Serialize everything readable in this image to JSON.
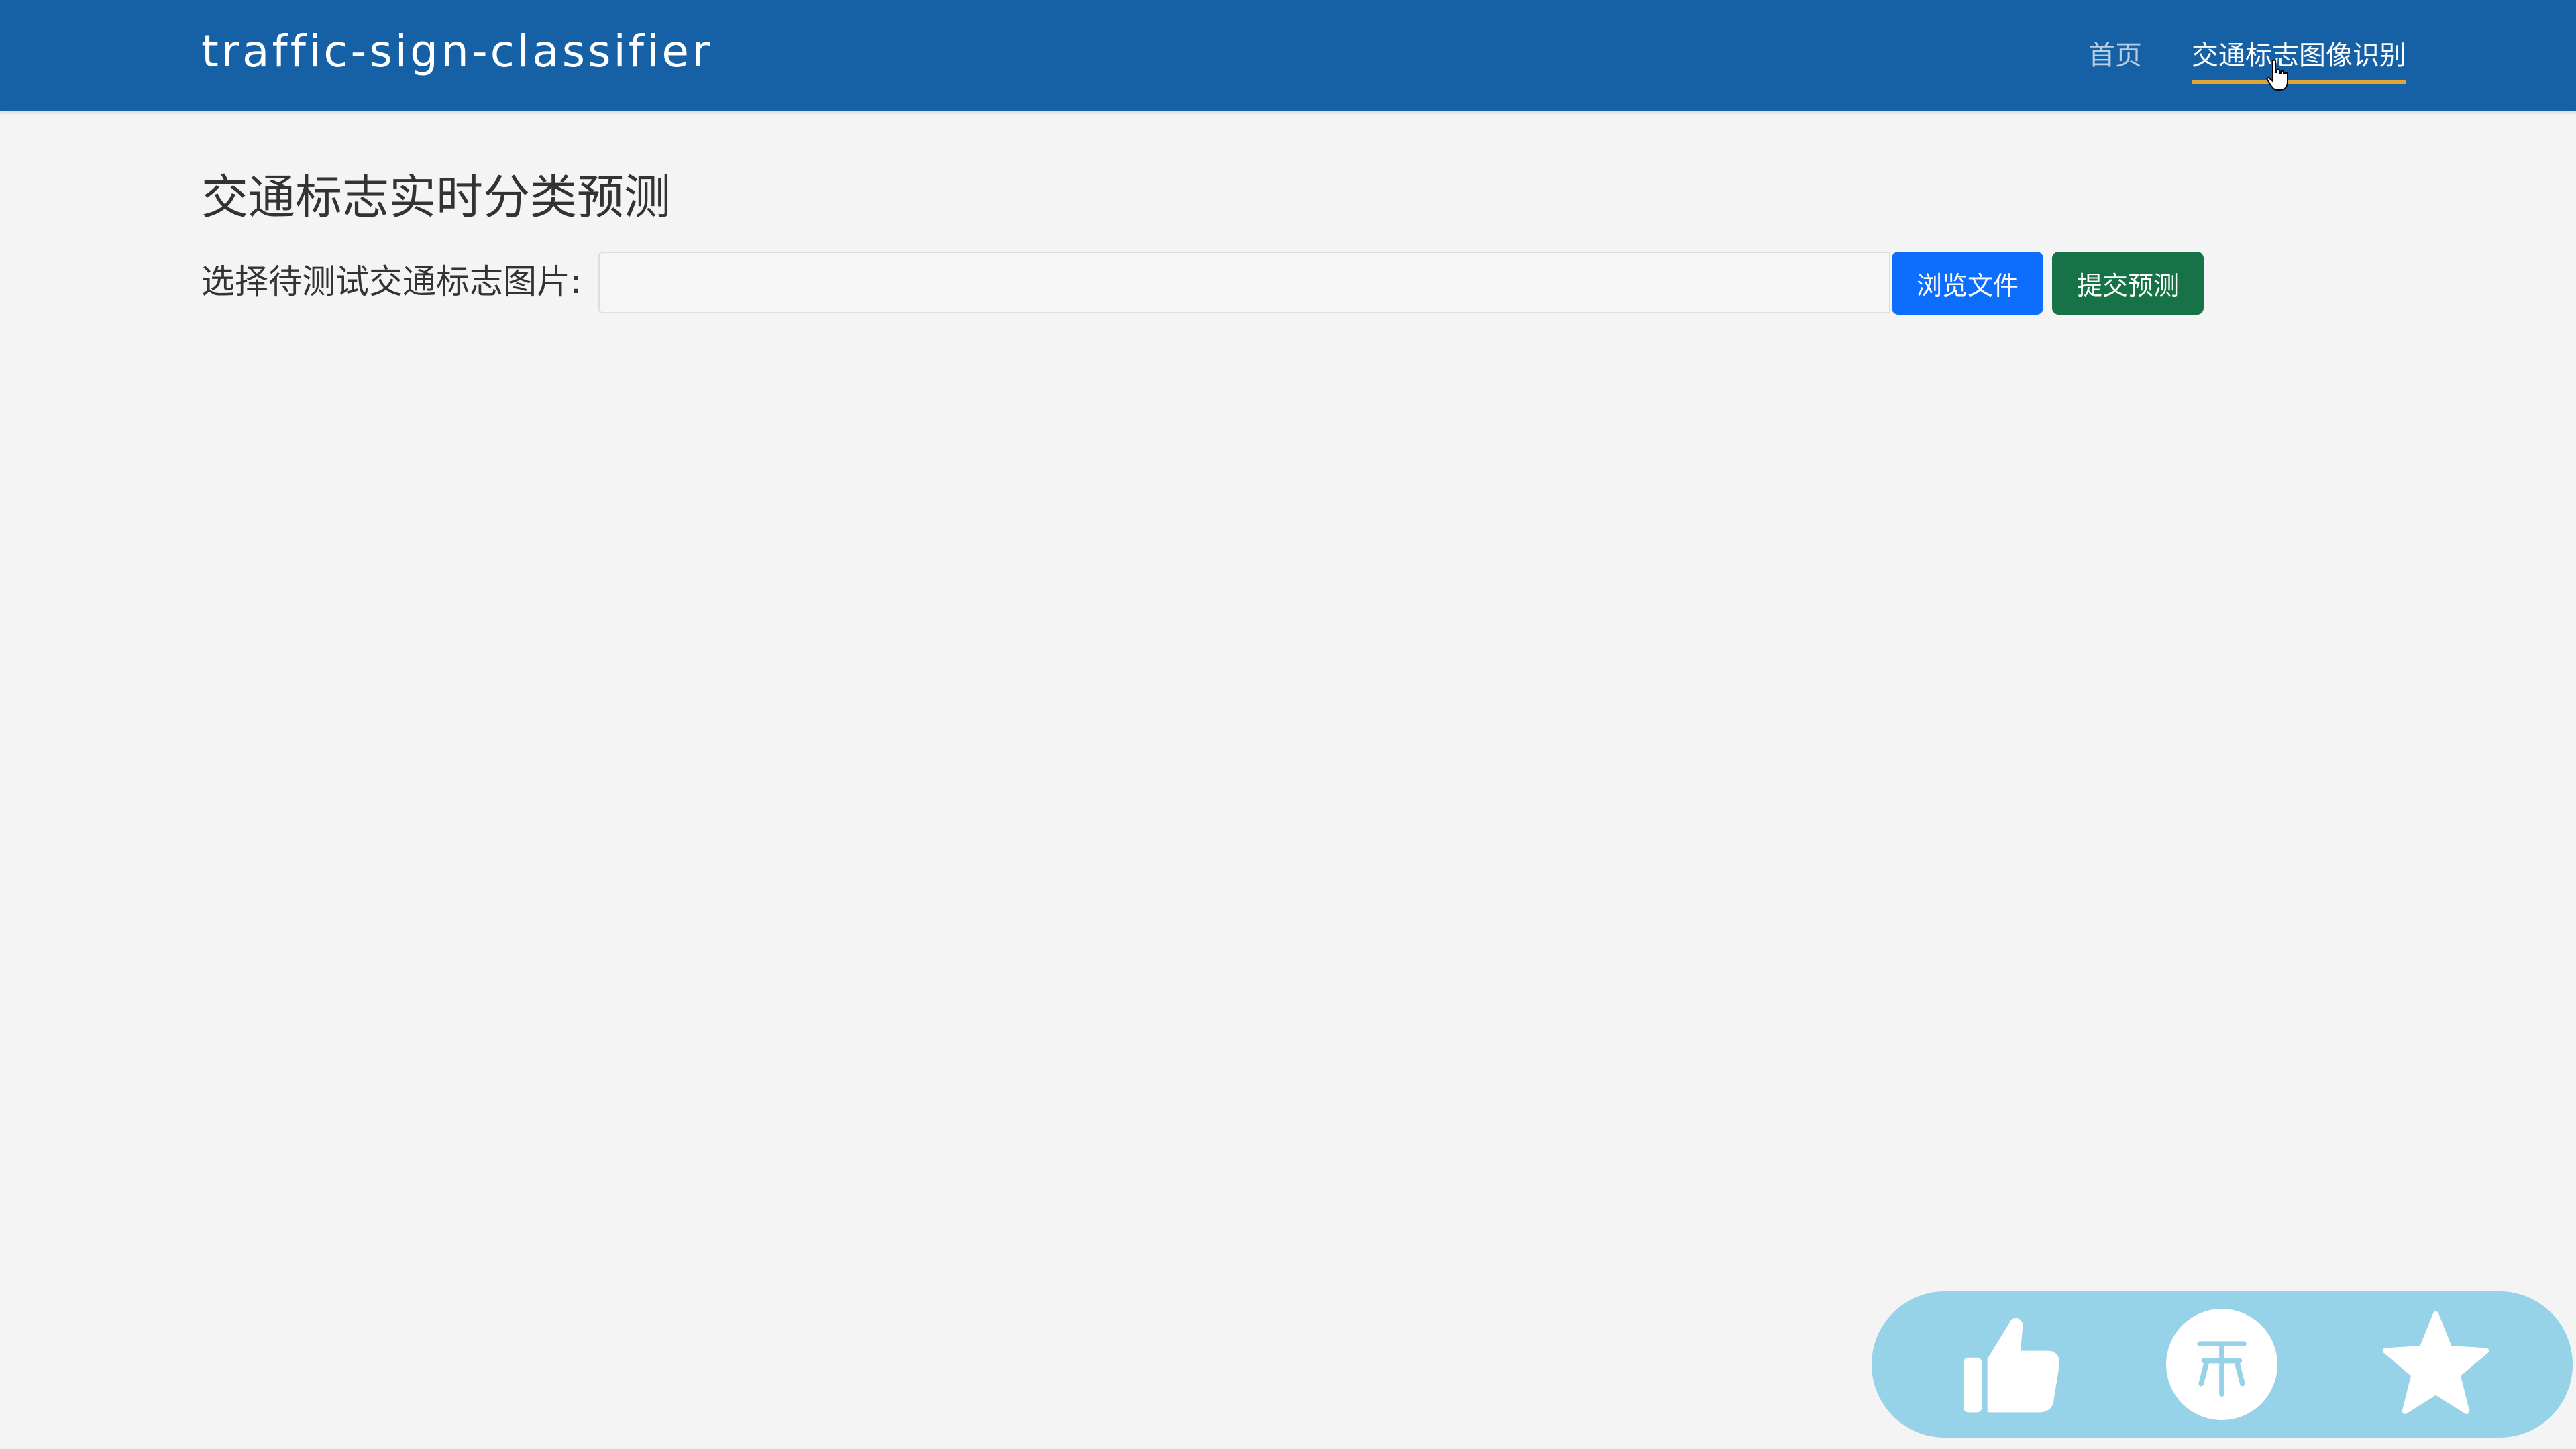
{
  "navbar": {
    "brand": "traffic-sign-classifier",
    "links": [
      {
        "label": "首页",
        "active": false
      },
      {
        "label": "交通标志图像识别",
        "active": true
      }
    ]
  },
  "main": {
    "title": "交通标志实时分类预测",
    "form": {
      "label": "选择待测试交通标志图片:",
      "file_input": {
        "value": "",
        "placeholder": ""
      },
      "browse_button": "浏览文件",
      "submit_button": "提交预测"
    }
  },
  "overlay": {
    "actions": [
      {
        "icon": "thumbs-up-icon"
      },
      {
        "icon": "coin-icon"
      },
      {
        "icon": "star-icon"
      }
    ]
  },
  "colors": {
    "navbar_bg": "#1661a6",
    "page_bg": "#f4f4f4",
    "browse_button": "#0d6efd",
    "submit_button": "#157347",
    "active_underline": "#e0a63a",
    "action_bar_bg": "#96d2e8"
  }
}
